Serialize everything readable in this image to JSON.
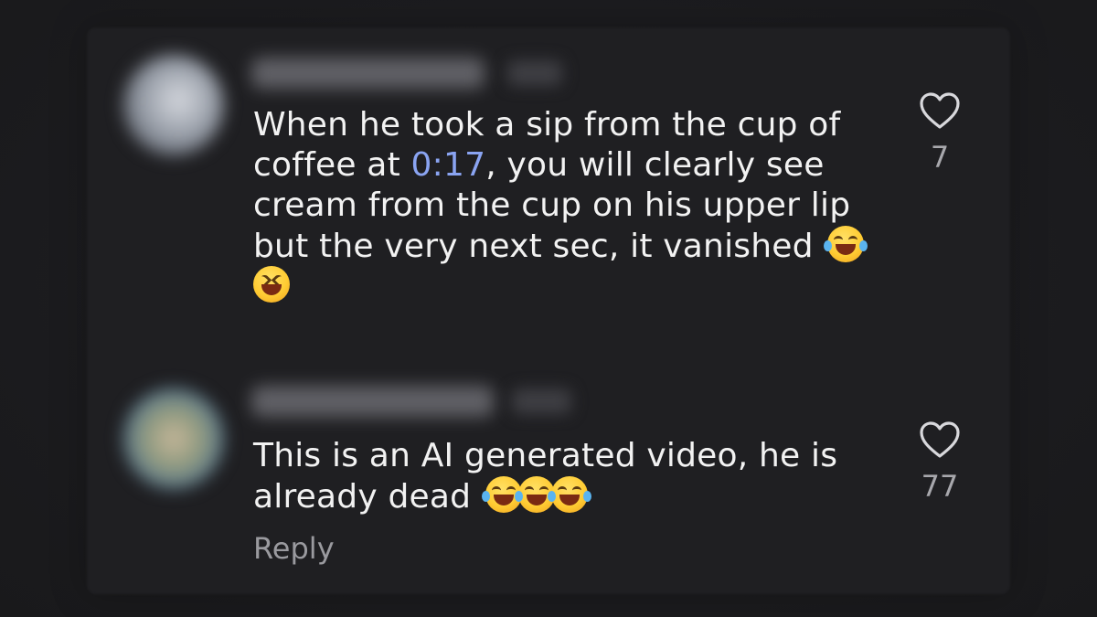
{
  "comments": [
    {
      "text_before_link": "When he took a sip from the cup of",
      "line2_start": "coffee at ",
      "timestamp_link": "0:17",
      "line2_end": ", you will clearly see",
      "line3": "cream from the cup on his upper lip",
      "line4": "but the very next sec, it vanished",
      "emojis": [
        "face-with-tears-of-joy",
        "grinning-squinting-face"
      ],
      "like_icon": "heart-outline-icon",
      "likes": "7"
    },
    {
      "line1": "This is an AI generated video, he is",
      "line2": "already dead",
      "emojis": [
        "face-with-tears-of-joy",
        "face-with-tears-of-joy",
        "face-with-tears-of-joy"
      ],
      "like_icon": "heart-outline-icon",
      "likes": "77",
      "reply_label": "Reply"
    }
  ],
  "colors": {
    "background": "#1b1b1d",
    "text": "#f2f2f2",
    "link": "#8aa4f2",
    "muted": "#9a9a9f"
  }
}
